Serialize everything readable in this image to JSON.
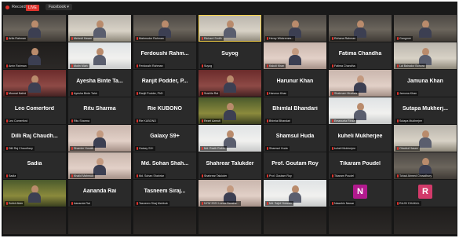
{
  "meeting": {
    "recording_label": "Recording",
    "live_label": "LIVE",
    "stream_label": "Facebook ▾",
    "tiles": [
      {
        "label": "Arifa Rahman",
        "big": "",
        "style": "video"
      },
      {
        "label": "Mehedi Hasan",
        "big": "",
        "style": "video light"
      },
      {
        "label": "Mahmudur Rahman",
        "big": "",
        "style": "video"
      },
      {
        "label": "Richard Smith",
        "big": "",
        "style": "video light",
        "active": true
      },
      {
        "label": "Henry Wickremes...",
        "big": "",
        "style": "video"
      },
      {
        "label": "Rehana Rahman",
        "big": "",
        "style": "video"
      },
      {
        "label": "Gangmer",
        "big": "",
        "style": "video"
      },
      {
        "label": "Amin Rahman",
        "big": "",
        "style": "video dark"
      },
      {
        "label": "Motin Miah",
        "big": "",
        "style": "video white"
      },
      {
        "label": "Ferdoushi Rahman",
        "big": "Ferdoushi Rahm...",
        "style": "name"
      },
      {
        "label": "Suyog",
        "big": "Suyog",
        "style": "name"
      },
      {
        "label": "Kakoli Khan",
        "big": "",
        "style": "video pink"
      },
      {
        "label": "Fatima Chandha",
        "big": "Fatima Chandha",
        "style": "name"
      },
      {
        "label": "Lal Bahadur Bohora",
        "big": "",
        "style": "video light"
      },
      {
        "label": "Moonai Nahid",
        "big": "",
        "style": "video red"
      },
      {
        "label": "Ayesha Binte Tahir",
        "big": "Ayesha Binte Ta...",
        "style": "name"
      },
      {
        "label": "Ranjit Podder, PhD",
        "big": "Ranjit Podder, P...",
        "style": "name"
      },
      {
        "label": "Sushila Rai",
        "big": "",
        "style": "video red"
      },
      {
        "label": "Harunur Khan",
        "big": "Harunur Khan",
        "style": "name"
      },
      {
        "label": "Shabnam Mustafa",
        "big": "",
        "style": "video pink"
      },
      {
        "label": "Jamuna Khan",
        "big": "Jamuna Khan",
        "style": "name"
      },
      {
        "label": "Leo Comerford",
        "big": "Leo Comerford",
        "style": "name"
      },
      {
        "label": "Ritu Sharma",
        "big": "Ritu Sharma",
        "style": "name"
      },
      {
        "label": "Rie KUBONO",
        "big": "Rie KUBONO",
        "style": "name"
      },
      {
        "label": "Rezel Azmuti",
        "big": "",
        "style": "video green"
      },
      {
        "label": "Bhimlal Bhandari",
        "big": "Bhimlal Bhandari",
        "style": "name"
      },
      {
        "label": "Emanuela Rinza",
        "big": "",
        "style": "video white"
      },
      {
        "label": "Sutapa Mukherjee",
        "big": "Sutapa Mukherj...",
        "style": "name"
      },
      {
        "label": "Dilli Raj Chaudhary",
        "big": "Dilli Raj Chaudh...",
        "style": "name"
      },
      {
        "label": "Shamim Hosain",
        "big": "",
        "style": "video pink"
      },
      {
        "label": "Galaxy S9+",
        "big": "Galaxy S9+",
        "style": "name"
      },
      {
        "label": "Md. Razib Rabbi",
        "big": "",
        "style": "video white"
      },
      {
        "label": "Shamsul Huda",
        "big": "Shamsul Huda",
        "style": "name"
      },
      {
        "label": "kuheli Mukherjee",
        "big": "kuheli Mukherjee",
        "style": "name"
      },
      {
        "label": "Obaidul Hasan",
        "big": "",
        "style": "video light"
      },
      {
        "label": "Sadia",
        "big": "Sadia",
        "style": "name"
      },
      {
        "label": "Khalid Mahmud",
        "big": "",
        "style": "video pink"
      },
      {
        "label": "Md. Sohan Shahriar",
        "big": "Md. Sohan Shah...",
        "style": "name"
      },
      {
        "label": "Shahrear Talukder",
        "big": "Shahrear Talukder",
        "style": "name"
      },
      {
        "label": "Prof. Goutam Roy",
        "big": "Prof. Goutam Roy",
        "style": "name"
      },
      {
        "label": "Tikaram Poudel",
        "big": "Tikaram Poudel",
        "style": "name"
      },
      {
        "label": "Tohad Ahmed Chowdhury",
        "big": "",
        "style": "video"
      },
      {
        "label": "Sohid Akter",
        "big": "",
        "style": "video green"
      },
      {
        "label": "Aananda Rai",
        "big": "Aananda Rai",
        "style": "name"
      },
      {
        "label": "Tasneem Siraj Mahbub",
        "big": "Tasneem Siraj...",
        "style": "name"
      },
      {
        "label": "NYW 2021 Londa Bansha...",
        "big": "",
        "style": "video pink"
      },
      {
        "label": "Md. Sajid Hossain",
        "big": "",
        "style": "video white"
      },
      {
        "label": "Nawshin Nawar",
        "big": "",
        "style": "avatar",
        "letter": "N",
        "color": "#b21a8e"
      },
      {
        "label": "RAJIV DHAKAL",
        "big": "",
        "style": "avatar",
        "letter": "R",
        "color": "#d23a6a"
      },
      {
        "label": "",
        "big": "",
        "style": "video dark"
      },
      {
        "label": "",
        "big": "",
        "style": "video dark"
      },
      {
        "label": "",
        "big": "",
        "style": "video dark"
      },
      {
        "label": "",
        "big": "",
        "style": "video dark"
      },
      {
        "label": "",
        "big": "",
        "style": "video dark"
      },
      {
        "label": "",
        "big": "",
        "style": "video dark"
      },
      {
        "label": "",
        "big": "",
        "style": "video dark"
      }
    ]
  }
}
